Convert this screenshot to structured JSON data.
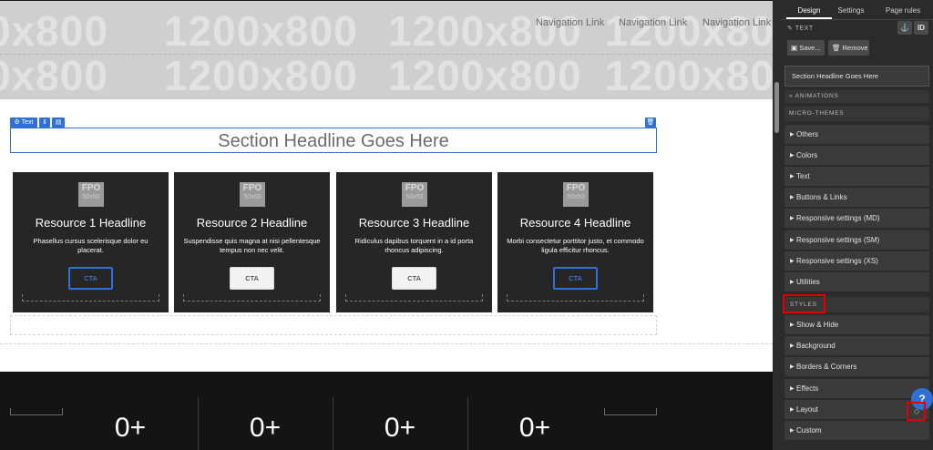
{
  "canvas": {
    "placeholder_text": "1200x800",
    "placeholder_fragment": "0x800",
    "nav_links": [
      "Navigation Link",
      "Navigation Link",
      "Navigation Link"
    ],
    "selected_label": "Text",
    "headline": "Section Headline Goes Here",
    "fpo": {
      "label": "FPO",
      "size": "50x50"
    },
    "cards": [
      {
        "title": "Resource 1 Headline",
        "text": "Phasellus cursus scelerisque dolor eu placerat.",
        "cta": "CTA",
        "cta_style": "outline"
      },
      {
        "title": "Resource 2 Headline",
        "text": "Suspendisse quis magna at nisi pellentesque tempus non nec velit.",
        "cta": "CTA",
        "cta_style": "solid"
      },
      {
        "title": "Resource 3 Headline",
        "text": "Ridiculus dapibus torquent in a id porta rhoncus adipiscing.",
        "cta": "CTA",
        "cta_style": "solid"
      },
      {
        "title": "Resource 4 Headline",
        "text": "Morbi consectetur porttitor justo, et commodo ligula efficitur rhoncus.",
        "cta": "CTA",
        "cta_style": "outline"
      }
    ],
    "stats": [
      "0+",
      "0+",
      "0+",
      "0+"
    ]
  },
  "panel": {
    "tabs": [
      "Design",
      "Settings",
      "Page rules"
    ],
    "active_tab": "Design",
    "element_type": "TEXT",
    "anchor_icon": "anchor-icon",
    "id_label": "ID",
    "save_label": "Save...",
    "remove_label": "Remove",
    "selected_element": "Section Headline Goes Here",
    "animations_label": "ANIMATIONS",
    "micro_themes_label": "MICRO-THEMES",
    "micro_themes": [
      "Others",
      "Colors",
      "Text",
      "Buttons & Links",
      "Responsive settings (MD)",
      "Responsive settings (SM)",
      "Responsive settings (XS)",
      "Utilities"
    ],
    "styles_label": "STYLES",
    "styles": [
      "Show & Hide",
      "Background",
      "Borders & Corners",
      "Effects",
      "Layout",
      "Custom"
    ],
    "help_label": "?",
    "highlight_color": "#e00000",
    "accent_color": "#2f6fd6"
  }
}
